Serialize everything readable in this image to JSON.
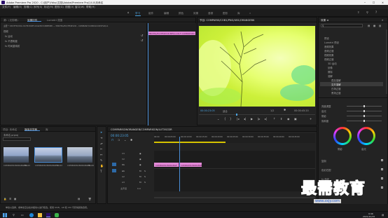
{
  "title_bar": {
    "title": "Adobe Premiere Pro 2020 - C:\\用户\\Ydisc\\文档\\Adobe\\Premiere Pro\\14.0\\未命名"
  },
  "menu": [
    "文件(F)",
    "编辑(E)",
    "剪辑(C)",
    "序列(S)",
    "标记(M)",
    "图形(G)",
    "视图(V)",
    "窗口(W)",
    "帮助(H)"
  ],
  "workspaces": {
    "items": [
      "学习",
      "组件",
      "编辑",
      "颜色",
      "效果",
      "音频",
      "图形",
      "库"
    ],
    "active_index": 0
  },
  "source_panel": {
    "tabs": [
      "源：(无剪辑)",
      "效果控件",
      "Lumetri 范围"
    ],
    "active_tab": 1,
    "header_line": "主要 * 15D7FD/V01.CS7PC3OPT-COLD5CV48PIMP0 ⌄  38D7PG/PX/3FD6VCR - COMPANY/COB1SICCDSFLD/L1",
    "sections": [
      "视频",
      "fx 运动",
      "fx 不透明度",
      "fx 时间重映射"
    ],
    "clip_label": "38D7PG/PX/3FD6VCR.BP5/L1.RLF COMPARIS6O"
  },
  "program_monitor": {
    "tab": "节目: COMPARIS/COB1/PNG/UB1/ORANGEBK",
    "timecode_left": "00:00:23:05",
    "fit": "适合",
    "zoom": "1/2",
    "timecode_right": "00:00:45:20"
  },
  "effects_panel": {
    "tab": "效果 ≡",
    "tree": [
      "预设",
      "Lumetri 预设",
      "音频效果",
      "音频过渡",
      "视频效果",
      "视频过渡",
      "3D 运动",
      "划像",
      "擦除",
      "溶解",
      "叠加溶解",
      "交叉溶解",
      "白场过渡",
      "黑场过渡"
    ],
    "selected_index": 11,
    "search": ""
  },
  "lumetri": {
    "rows": [
      "亮度调整",
      "高光",
      "阴影",
      "饱和度"
    ],
    "wheels": [
      "阴影",
      "中间调",
      "高光"
    ],
    "bottom_rows": [
      "复制",
      "色彩匹配",
      "fx 曲线",
      "晕影"
    ]
  },
  "project_panel": {
    "tabs": [
      "项目: 未命名",
      "媒体浏览器",
      "库"
    ],
    "active_tab": 0,
    "path": "未命名.prproj",
    "clips": [
      {
        "name": "COMPARISONORANGEB...",
        "duration": "14:02"
      },
      {
        "name": "COMPARISONORANGEB...",
        "duration": "10:22"
      },
      {
        "name": "COMPARISONORANGEB...",
        "duration": "11:06"
      }
    ]
  },
  "timeline": {
    "tab": "COMPARISONORANGEB/COMPARISON/LUT3SCDR",
    "timecode": "00:00:23:05",
    "ruler": [
      "00:00",
      "00:00:05:00",
      "00:00:10:00",
      "00:00:15:00",
      "00:00:20:00",
      "00:00:25:00",
      "00:00:30:00",
      "00:00:35:00",
      "00:00:40:00",
      "00:00:45:00"
    ],
    "tracks": [
      "V3",
      "V2",
      "V1",
      "A1",
      "A2",
      "A3",
      "主声道"
    ],
    "clips": [
      {
        "label": "COMPARISONORANGE"
      },
      {
        "label": "COMPARISONORANGE"
      }
    ],
    "master_value": "0.0"
  },
  "status": {
    "text": "单击以选择，或单击空白处并拖动以进行框选。使用 Shift、Alt 和 Ctrl 可获得其他选项。"
  },
  "watermark": {
    "text": "最需教育",
    "sub": "www.zxjy.com"
  },
  "taskbar": {
    "time": "9:46",
    "date": "2021/10/15"
  }
}
